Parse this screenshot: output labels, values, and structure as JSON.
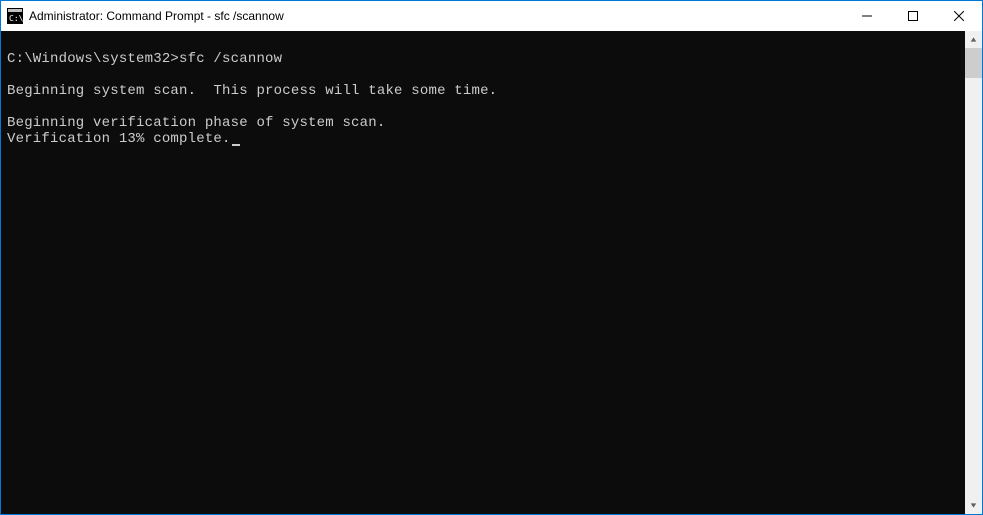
{
  "window": {
    "title": "Administrator: Command Prompt - sfc  /scannow"
  },
  "console": {
    "prompt": "C:\\Windows\\system32>",
    "command": "sfc /scannow",
    "lines": {
      "l1": "Beginning system scan.  This process will take some time.",
      "l2": "Beginning verification phase of system scan.",
      "l3": "Verification 13% complete."
    },
    "progress_percent": 13
  }
}
